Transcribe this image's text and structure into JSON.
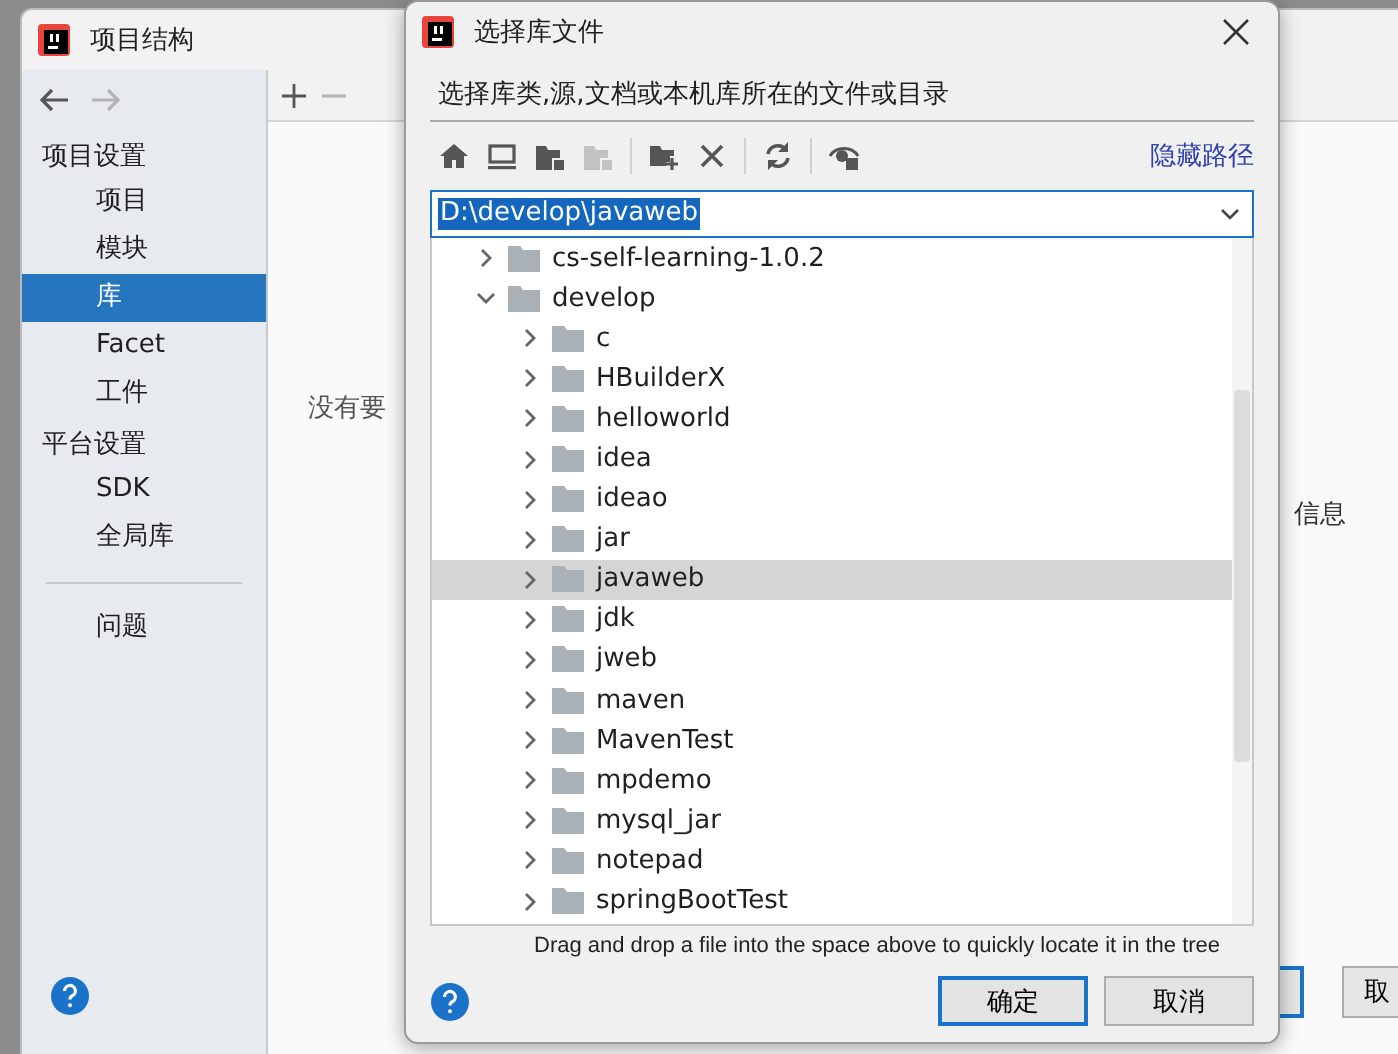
{
  "main_window": {
    "title": "项目结构",
    "nav": [
      {
        "kind": "back",
        "disabled": false
      },
      {
        "kind": "forward",
        "disabled": true
      }
    ],
    "sidebar": {
      "sections": [
        {
          "title": "项目设置",
          "items": [
            {
              "label": "项目",
              "selected": false
            },
            {
              "label": "模块",
              "selected": false
            },
            {
              "label": "库",
              "selected": true
            },
            {
              "label": "Facet",
              "selected": false
            },
            {
              "label": "工件",
              "selected": false
            }
          ]
        },
        {
          "title": "平台设置",
          "items": [
            {
              "label": "SDK",
              "selected": false
            },
            {
              "label": "全局库",
              "selected": false
            }
          ]
        }
      ],
      "extra_items": [
        {
          "label": "问题",
          "selected": false
        }
      ]
    },
    "empty_message": "没有要",
    "detail_label": "信息",
    "cancel_button": "取"
  },
  "dialog": {
    "title": "选择库文件",
    "description": "选择库类,源,文档或本机库所在的文件或目录",
    "toolbar": [
      {
        "kind": "home",
        "disabled": false
      },
      {
        "kind": "desktop",
        "disabled": false
      },
      {
        "kind": "project",
        "disabled": false
      },
      {
        "kind": "module",
        "disabled": true
      },
      {
        "kind": "separator"
      },
      {
        "kind": "new-folder",
        "disabled": false
      },
      {
        "kind": "delete",
        "disabled": false
      },
      {
        "kind": "separator"
      },
      {
        "kind": "refresh",
        "disabled": false
      },
      {
        "kind": "separator"
      },
      {
        "kind": "hidden-files",
        "disabled": false
      }
    ],
    "hide_path_link": "隐藏路径",
    "path": "D:\\develop\\javaweb",
    "tree": [
      {
        "label": "cs-self-learning-1.0.2",
        "expanded": false,
        "selected": false
      },
      {
        "label": "develop",
        "expanded": true,
        "selected": false,
        "children": [
          {
            "label": "c",
            "expanded": false,
            "selected": false
          },
          {
            "label": "HBuilderX",
            "expanded": false,
            "selected": false
          },
          {
            "label": "helloworld",
            "expanded": false,
            "selected": false
          },
          {
            "label": "idea",
            "expanded": false,
            "selected": false
          },
          {
            "label": "ideao",
            "expanded": false,
            "selected": false
          },
          {
            "label": "jar",
            "expanded": false,
            "selected": false
          },
          {
            "label": "javaweb",
            "expanded": false,
            "selected": true
          },
          {
            "label": "jdk",
            "expanded": false,
            "selected": false
          },
          {
            "label": "jweb",
            "expanded": false,
            "selected": false
          },
          {
            "label": "maven",
            "expanded": false,
            "selected": false
          },
          {
            "label": "MavenTest",
            "expanded": false,
            "selected": false
          },
          {
            "label": "mpdemo",
            "expanded": false,
            "selected": false
          },
          {
            "label": "mysql_jar",
            "expanded": false,
            "selected": false
          },
          {
            "label": "notepad",
            "expanded": false,
            "selected": false
          },
          {
            "label": "springBootTest",
            "expanded": false,
            "selected": false
          }
        ]
      }
    ],
    "hint": "Drag and drop a file into the space above to quickly locate it in the tree",
    "buttons": [
      {
        "label": "确定",
        "default": true
      },
      {
        "label": "取消",
        "default": false
      }
    ]
  }
}
